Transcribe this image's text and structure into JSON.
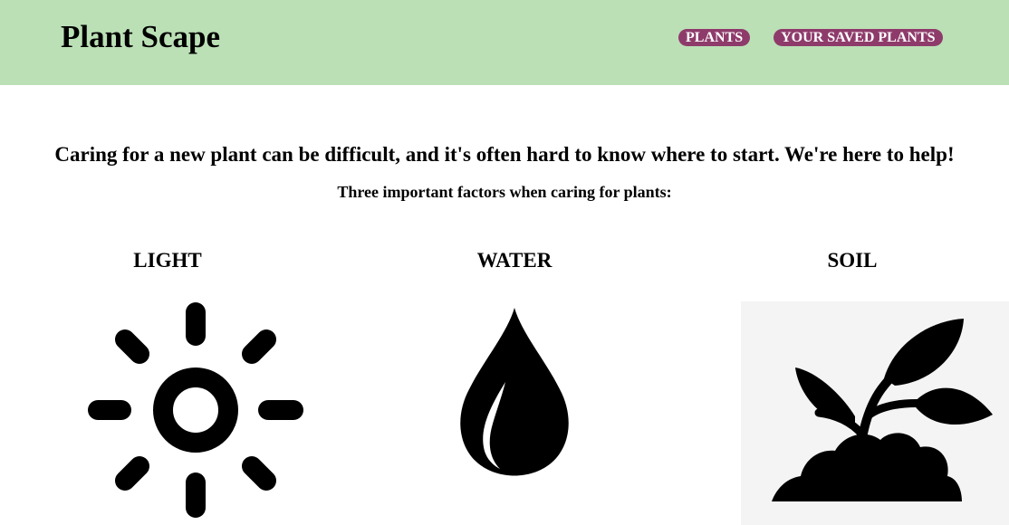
{
  "header": {
    "title": "Plant Scape",
    "nav": [
      {
        "label": "PLANTS"
      },
      {
        "label": "YOUR SAVED PLANTS"
      }
    ],
    "background_color": "#bbe0b6",
    "nav_color": "#8e3b6b"
  },
  "main": {
    "headline": "Caring for a new plant can be difficult, and it's often hard to know where to start. We're here to help!",
    "subheadline": "Three important factors when caring for plants:",
    "factors": [
      {
        "title": "LIGHT",
        "icon": "sun-icon"
      },
      {
        "title": "WATER",
        "icon": "water-drop-icon"
      },
      {
        "title": "SOIL",
        "icon": "seedling-icon"
      }
    ]
  }
}
